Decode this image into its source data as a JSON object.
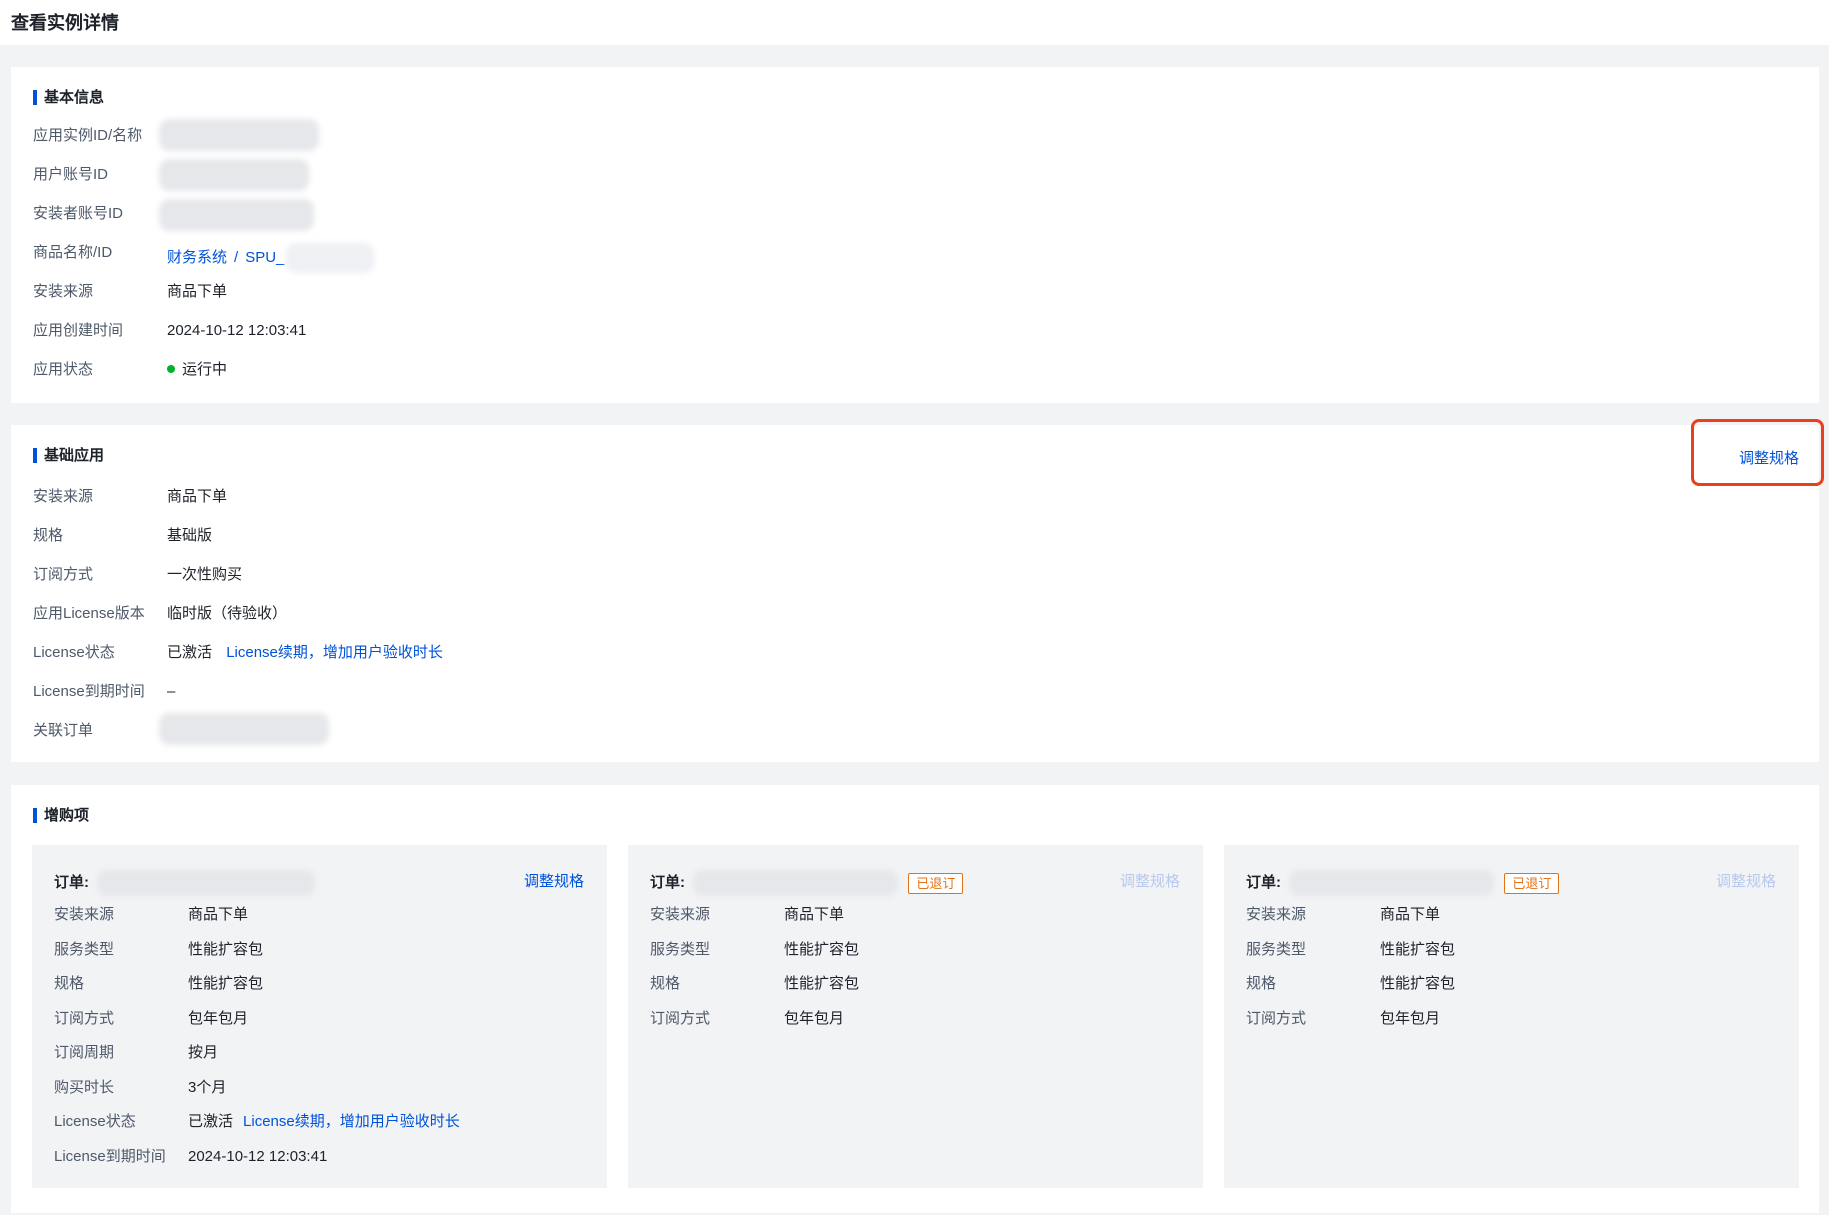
{
  "page": {
    "title": "查看实例详情"
  },
  "basic": {
    "title": "基本信息",
    "rows": [
      {
        "label": "应用实例ID/名称"
      },
      {
        "label": "用户账号ID"
      },
      {
        "label": "安装者账号ID"
      },
      {
        "label": "商品名称/ID",
        "product_name": "财务系统",
        "separator": "/",
        "spu_prefix": "SPU_"
      },
      {
        "label": "安装来源",
        "value": "商品下单"
      },
      {
        "label": "应用创建时间",
        "value": "2024-10-12 12:03:41"
      },
      {
        "label": "应用状态",
        "value": "运行中",
        "status_color": "#00b42a"
      }
    ]
  },
  "base_app": {
    "title": "基础应用",
    "adjust_label": "调整规格",
    "rows": [
      {
        "label": "安装来源",
        "value": "商品下单"
      },
      {
        "label": "规格",
        "value": "基础版"
      },
      {
        "label": "订阅方式",
        "value": "一次性购买"
      },
      {
        "label": "应用License版本",
        "value": "临时版（待验收）"
      },
      {
        "label": "License状态",
        "value": "已激活",
        "link": "License续期，增加用户验收时长"
      },
      {
        "label": "License到期时间",
        "value": "–"
      },
      {
        "label": "关联订单"
      }
    ]
  },
  "addons": {
    "title": "增购项",
    "orders": [
      {
        "order_label": "订单:",
        "adjust_label": "调整规格",
        "rows": [
          {
            "label": "安装来源",
            "value": "商品下单"
          },
          {
            "label": "服务类型",
            "value": "性能扩容包"
          },
          {
            "label": "规格",
            "value": "性能扩容包"
          },
          {
            "label": "订阅方式",
            "value": "包年包月"
          },
          {
            "label": "订阅周期",
            "value": "按月"
          },
          {
            "label": "购买时长",
            "value": "3个月"
          },
          {
            "label": "License状态",
            "value": "已激活",
            "link": "License续期，增加用户验收时长"
          },
          {
            "label": "License到期时间",
            "value": "2024-10-12 12:03:41"
          }
        ]
      },
      {
        "order_label": "订单:",
        "badge": "已退订",
        "adjust_label": "调整规格",
        "rows": [
          {
            "label": "安装来源",
            "value": "商品下单"
          },
          {
            "label": "服务类型",
            "value": "性能扩容包"
          },
          {
            "label": "规格",
            "value": "性能扩容包"
          },
          {
            "label": "订阅方式",
            "value": "包年包月"
          }
        ]
      },
      {
        "order_label": "订单:",
        "badge": "已退订",
        "adjust_label": "调整规格",
        "rows": [
          {
            "label": "安装来源",
            "value": "商品下单"
          },
          {
            "label": "服务类型",
            "value": "性能扩容包"
          },
          {
            "label": "规格",
            "value": "性能扩容包"
          },
          {
            "label": "订阅方式",
            "value": "包年包月"
          }
        ]
      }
    ]
  },
  "colors": {
    "accent": "#0052d9",
    "status_running": "#00b42a",
    "badge_orange": "#e37318",
    "highlight_red": "#e8401c"
  }
}
